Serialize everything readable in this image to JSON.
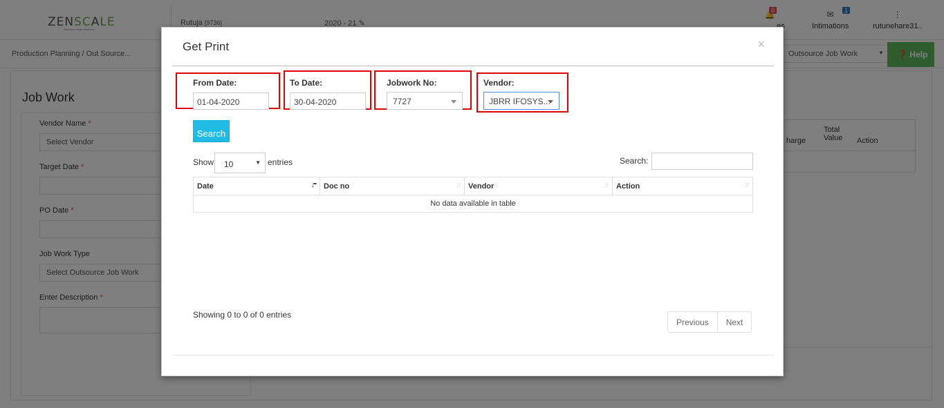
{
  "app": {
    "logo": {
      "text_a": "ZEN",
      "text_b": "SC",
      "text_c": "A",
      "text_d": "LE",
      "tagline": "Business made effortless"
    },
    "user": {
      "name": "Rutuja",
      "id": "[9736]"
    },
    "year": "2020 - 21",
    "notifications": {
      "badge": "0",
      "label": "...es"
    },
    "intimations": {
      "badge": "1",
      "label": "Intimations"
    },
    "account": {
      "label": "rutunehare31.."
    }
  },
  "breadcrumb": "Production Planning  / Out Source...",
  "bg_select": "Outsource Job Work",
  "help_label": "Help",
  "form": {
    "title": "Job Work",
    "vendor_label": "Vendor Name",
    "vendor_placeholder": "Select Vendor",
    "target_label": "Target Date",
    "po_label": "PO Date",
    "type_label": "Job Work Type",
    "type_placeholder": "Select Outsource Job Work",
    "desc_label": "Enter Description"
  },
  "bg_table": {
    "col1": "harge",
    "col2a": "Total",
    "col2b": "Value",
    "col3": "Action"
  },
  "modal": {
    "title": "Get Print",
    "close": "×",
    "from_label": "From Date:",
    "from_value": "01-04-2020",
    "to_label": "To Date:",
    "to_value": "30-04-2020",
    "jobwork_label": "Jobwork No:",
    "jobwork_value": "7727",
    "vendor_label": "Vendor:",
    "vendor_value": "JBRR IFOSYS...",
    "search_button": "Search",
    "show_label": "Show",
    "entries_value": "10",
    "entries_label": "entries",
    "search_label": "Search:",
    "columns": [
      "Date",
      "Doc no",
      "Vendor",
      "Action"
    ],
    "empty_text": "No data available in table",
    "info_text": "Showing 0 to 0 of 0 entries",
    "prev_label": "Previous",
    "next_label": "Next"
  },
  "colors": {
    "highlight": "#e00000",
    "search_button": "#1fbde6",
    "help_button": "#5cb85c"
  }
}
